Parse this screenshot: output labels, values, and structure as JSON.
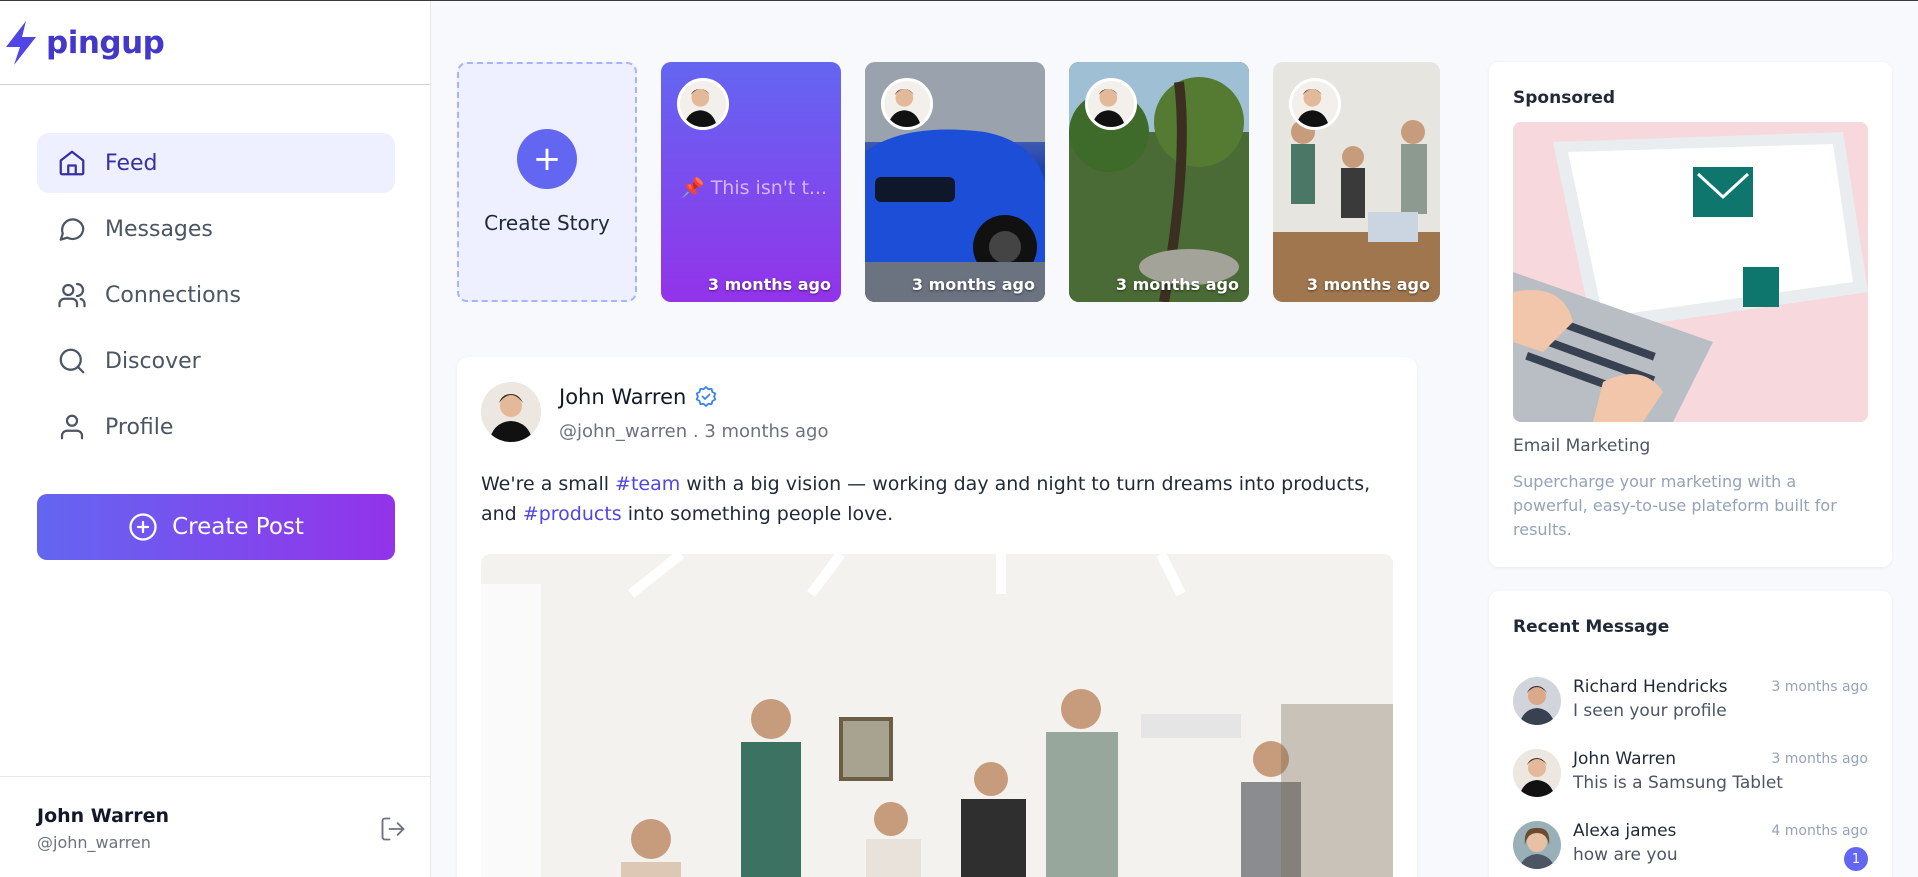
{
  "app": {
    "name": "pingup",
    "brand_color": "#4338ca",
    "accent_gradient": [
      "#6366f1",
      "#9333ea"
    ]
  },
  "sidebar": {
    "items": [
      {
        "label": "Feed",
        "icon": "home-icon",
        "active": true
      },
      {
        "label": "Messages",
        "icon": "message-circle-icon",
        "active": false
      },
      {
        "label": "Connections",
        "icon": "users-icon",
        "active": false
      },
      {
        "label": "Discover",
        "icon": "search-icon",
        "active": false
      },
      {
        "label": "Profile",
        "icon": "user-icon",
        "active": false
      }
    ],
    "create_post_label": "Create Post",
    "user": {
      "name": "John Warren",
      "handle": "@john_warren"
    }
  },
  "stories": {
    "create_label": "Create Story",
    "items": [
      {
        "text": "📌 This isn't t...",
        "time": "3 months ago"
      },
      {
        "time": "3 months ago"
      },
      {
        "time": "3 months ago"
      },
      {
        "time": "3 months ago"
      }
    ]
  },
  "post": {
    "author": "John Warren",
    "handle": "@john_warren",
    "time": "3 months ago",
    "meta_separator": " . ",
    "body": {
      "part1": "We're a small ",
      "tag1": "#team",
      "part2": " with a big vision — working day and night to turn dreams into products, and ",
      "tag2": "#products",
      "part3": " into something people love."
    }
  },
  "sponsored": {
    "title": "Sponsored",
    "ad_name": "Email Marketing",
    "ad_description": "Supercharge your marketing with a powerful, easy-to-use plateform built for results."
  },
  "recent_messages": {
    "title": "Recent Message",
    "items": [
      {
        "name": "Richard Hendricks",
        "text": "I seen your profile",
        "time": "3 months ago",
        "unread": null
      },
      {
        "name": "John Warren",
        "text": "This is a Samsung Tablet",
        "time": "3 months ago",
        "unread": null
      },
      {
        "name": "Alexa james",
        "text": "how are you",
        "time": "4 months ago",
        "unread": "1"
      }
    ]
  }
}
